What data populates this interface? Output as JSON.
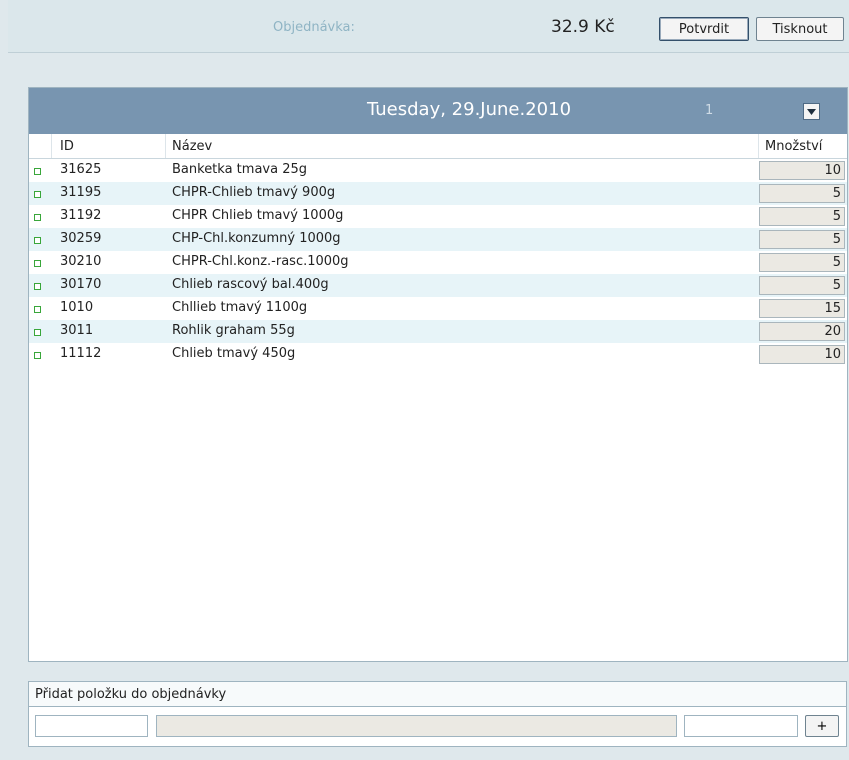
{
  "topbar": {
    "order_label": "Objednávka:",
    "total": "32.9 Kč",
    "confirm_label": "Potvrdit",
    "print_label": "Tisknout"
  },
  "panel": {
    "date_title": "Tuesday, 29.June.2010",
    "count": "1",
    "dropdown_icon": "chevron-down-icon",
    "columns": {
      "id": "ID",
      "name": "Název",
      "qty": "Množství"
    },
    "rows": [
      {
        "id": "31625",
        "name": "Banketka tmava 25g",
        "qty": "10"
      },
      {
        "id": "31195",
        "name": "CHPR-Chlieb tmavý 900g",
        "qty": "5"
      },
      {
        "id": "31192",
        "name": "CHPR Chlieb tmavý 1000g",
        "qty": "5"
      },
      {
        "id": "30259",
        "name": "CHP-Chl.konzumný 1000g",
        "qty": "5"
      },
      {
        "id": "30210",
        "name": "CHPR-Chl.konz.-rasc.1000g",
        "qty": "5"
      },
      {
        "id": "30170",
        "name": "Chlieb rascový bal.400g",
        "qty": "5"
      },
      {
        "id": "1010",
        "name": "Chllieb tmavý 1100g",
        "qty": "15"
      },
      {
        "id": "3011",
        "name": "Rohlik graham 55g",
        "qty": "20"
      },
      {
        "id": "11112",
        "name": "Chlieb tmavý 450g",
        "qty": "10"
      }
    ]
  },
  "add_item": {
    "label": "Přidat položku do objednávky",
    "code_value": "",
    "name_value": "",
    "qty_value": "",
    "add_label": "+"
  },
  "colors": {
    "header_bg": "#7895b0",
    "alt_row_bg": "#e7f4f8",
    "marker": "#39a63a",
    "page_bg": "#dfe8ec"
  }
}
